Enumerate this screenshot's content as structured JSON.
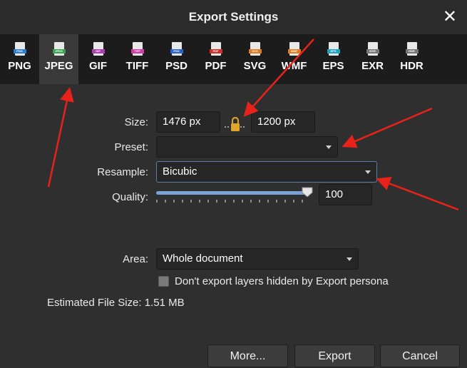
{
  "window": {
    "title": "Export Settings",
    "close_glyph": "✕"
  },
  "formats": [
    {
      "label": "PNG",
      "badge": "PNG",
      "color": "#2a7fd4",
      "selected": false
    },
    {
      "label": "JPEG",
      "badge": "JPEG",
      "color": "#3aa655",
      "selected": true
    },
    {
      "label": "GIF",
      "badge": "GIF",
      "color": "#b03fb0",
      "selected": false
    },
    {
      "label": "TIFF",
      "badge": "TIFF",
      "color": "#d63ca6",
      "selected": false
    },
    {
      "label": "PSD",
      "badge": "PSD",
      "color": "#2b66d0",
      "selected": false
    },
    {
      "label": "PDF",
      "badge": "PDF",
      "color": "#d22f2f",
      "selected": false
    },
    {
      "label": "SVG",
      "badge": "SVG",
      "color": "#e07b1e",
      "selected": false
    },
    {
      "label": "WMF",
      "badge": "WMF",
      "color": "#e07b1e",
      "selected": false
    },
    {
      "label": "EPS",
      "badge": "EPS",
      "color": "#1fa4c4",
      "selected": false
    },
    {
      "label": "EXR",
      "badge": "EXR",
      "color": "#777777",
      "selected": false
    },
    {
      "label": "HDR",
      "badge": "HDR",
      "color": "#777777",
      "selected": false
    }
  ],
  "size": {
    "label": "Size:",
    "width": "1476 px",
    "height": "1200 px"
  },
  "preset": {
    "label": "Preset:",
    "value": ""
  },
  "resample": {
    "label": "Resample:",
    "value": "Bicubic"
  },
  "quality": {
    "label": "Quality:",
    "value": "100",
    "level": 1.0
  },
  "area": {
    "label": "Area:",
    "value": "Whole document"
  },
  "hidden_layers": {
    "label": "Don't export layers hidden by Export persona",
    "checked": false
  },
  "file_size": {
    "text": "Estimated File Size: 1.51 MB"
  },
  "buttons": {
    "more": "More...",
    "export": "Export",
    "cancel": "Cancel"
  },
  "colors": {
    "accent": "#7aa2d6",
    "annotation_arrow": "#e8221b"
  }
}
